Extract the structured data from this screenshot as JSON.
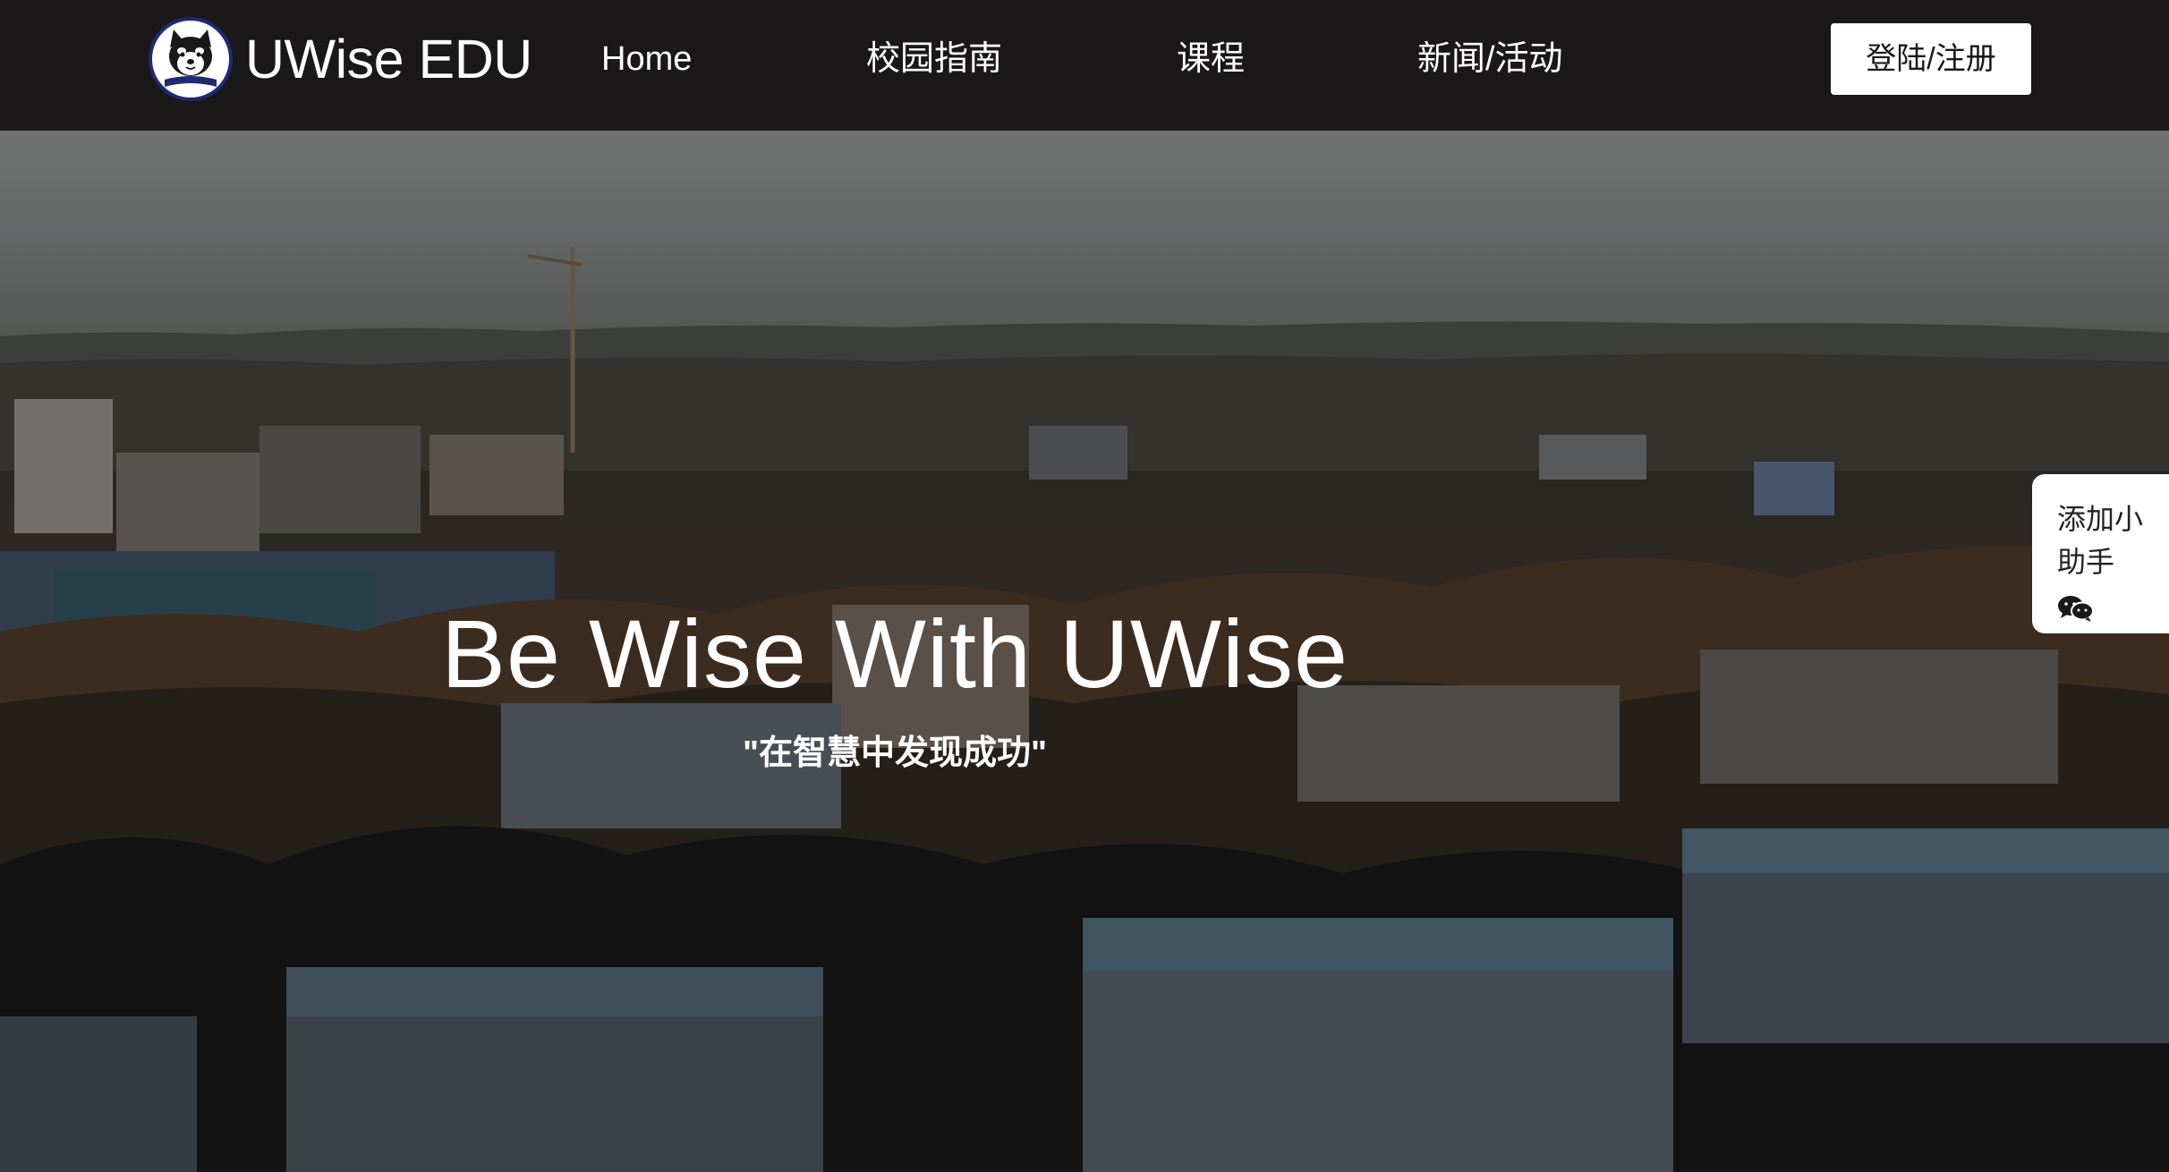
{
  "navbar": {
    "brand_name": "UWise EDU",
    "logo_icon": "shiba-dog-logo-icon",
    "items": [
      {
        "label": "Home"
      },
      {
        "label": "校园指南"
      },
      {
        "label": "课程"
      },
      {
        "label": "新闻/活动"
      }
    ],
    "login_label": "登陆/注册"
  },
  "hero": {
    "title": "Be Wise With UWise",
    "subtitle": "\"在智慧中发现成功\""
  },
  "helper": {
    "label": "添加小助手",
    "icon": "wechat-icon"
  },
  "colors": {
    "navbar_bg": "#1b1819",
    "logo_ring": "#1f2a72",
    "button_bg": "#ffffff",
    "text_light": "#ffffff"
  }
}
